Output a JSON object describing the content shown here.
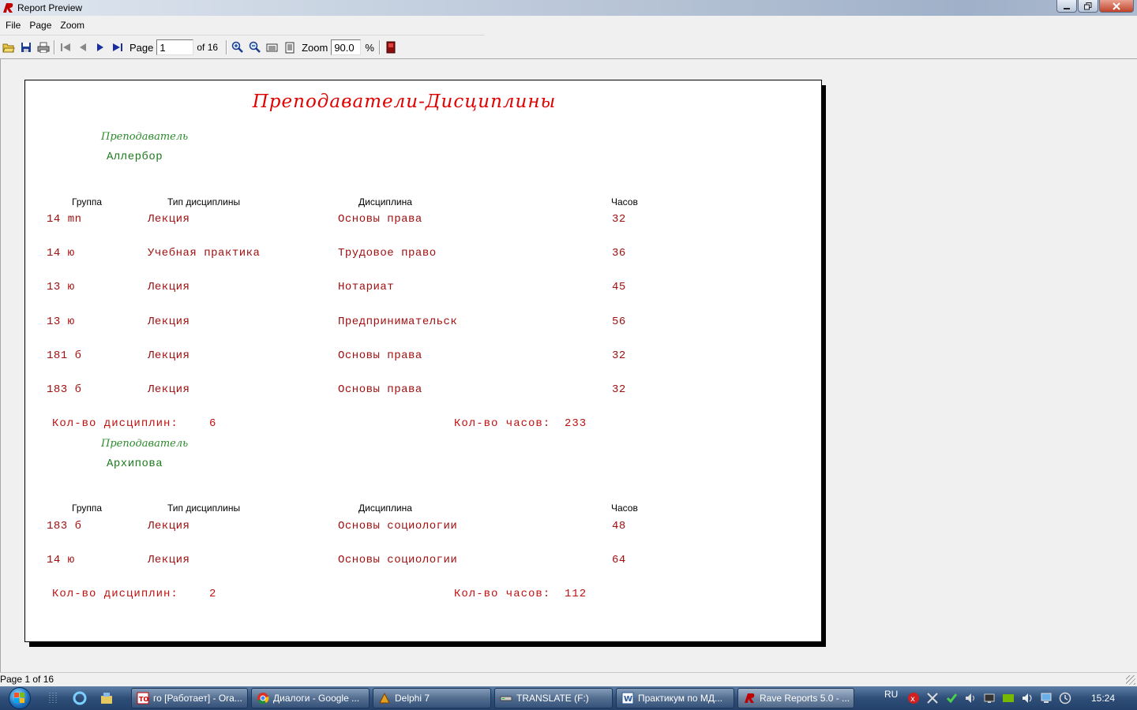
{
  "window": {
    "title": "Report Preview",
    "controls": [
      "minimize",
      "maximize",
      "close"
    ]
  },
  "menu": [
    "File",
    "Page",
    "Zoom"
  ],
  "toolbar": {
    "page_label": "Page",
    "page_value": "1",
    "of_label": "of 16",
    "zoom_label": "Zoom",
    "zoom_value": "90.0",
    "percent": "%",
    "icons": [
      "open-icon",
      "save-icon",
      "print-icon",
      "first-page-icon",
      "prev-page-icon",
      "next-page-icon",
      "last-page-icon",
      "zoom-in-icon",
      "zoom-out-icon",
      "page-width-icon",
      "page-whole-icon",
      "exit-icon"
    ]
  },
  "report": {
    "title": "Преподаватели-Дисциплины",
    "group_label": "Преподаватель",
    "columns": [
      "Группа",
      "Тип дисциплины",
      "Дисциплина",
      "Часов"
    ],
    "sum_disc_label": "Кол-во дисциплин:",
    "sum_hours_label": "Кол-во часов:",
    "groups": [
      {
        "teacher": "Аллербор",
        "rows": [
          [
            "14 mn",
            "Лекция",
            "Основы права",
            "32"
          ],
          [
            "14 ю",
            "Учебная практика",
            "Трудовое право",
            "36"
          ],
          [
            "13 ю",
            "Лекция",
            "Нотариат",
            "45"
          ],
          [
            "13 ю",
            "Лекция",
            "Предпринимательск",
            "56"
          ],
          [
            "181 б",
            "Лекция",
            "Основы права",
            "32"
          ],
          [
            "183 б",
            "Лекция",
            "Основы права",
            "32"
          ]
        ],
        "disc_count": "6",
        "hours_total": "233"
      },
      {
        "teacher": "Архипова",
        "rows": [
          [
            "183 б",
            "Лекция",
            "Основы социологии",
            "48"
          ],
          [
            "14 ю",
            "Лекция",
            "Основы социологии",
            "64"
          ]
        ],
        "disc_count": "2",
        "hours_total": "112"
      }
    ]
  },
  "status": {
    "text": "Page 1 of 16"
  },
  "taskbar": {
    "buttons": [
      "го [Работает] - Ora...",
      "Диалоги - Google ...",
      "Delphi 7",
      "TRANSLATE (F:)",
      "Практикум по МД...",
      "Rave Reports 5.0 - ..."
    ],
    "lang": "RU",
    "time": "15:24"
  }
}
